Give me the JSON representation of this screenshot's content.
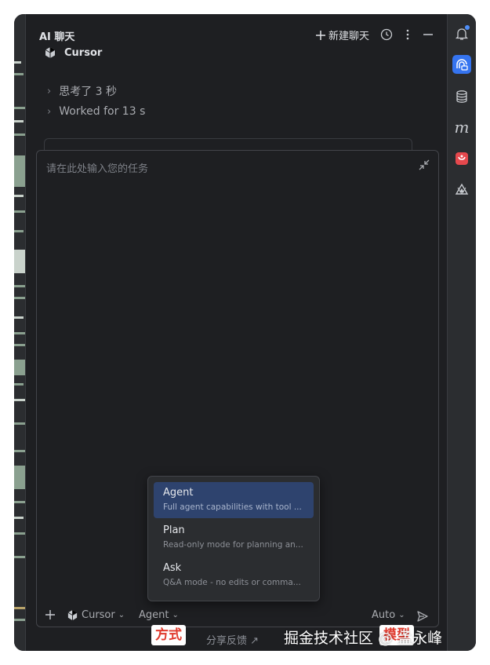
{
  "panel": {
    "title": "AI 聊天",
    "new_chat_label": "新建聊天"
  },
  "messages": {
    "agent_name": "Cursor",
    "thought_label": "思考了 3 秒",
    "worked_label": "Worked for 13 s"
  },
  "input": {
    "placeholder": "请在此处输入您的任务"
  },
  "mode_menu": {
    "items": [
      {
        "title": "Agent",
        "desc": "Full agent capabilities with tool ...",
        "selected": true
      },
      {
        "title": "Plan",
        "desc": "Read-only mode for planning an...",
        "selected": false
      },
      {
        "title": "Ask",
        "desc": "Q&A mode - no edits or comma...",
        "selected": false
      }
    ]
  },
  "toolbar": {
    "model_label": "Cursor",
    "mode_label": "Agent",
    "auto_label": "Auto"
  },
  "footer": {
    "share_feedback": "分享反馈 ↗",
    "annotation_left": "方式",
    "annotation_right": "模型"
  },
  "watermark": "掘金技术社区 @ 孟永峰",
  "colors": {
    "accent": "#3574f0",
    "selected_item": "#2e436e",
    "annotation_red": "#e0392c"
  }
}
